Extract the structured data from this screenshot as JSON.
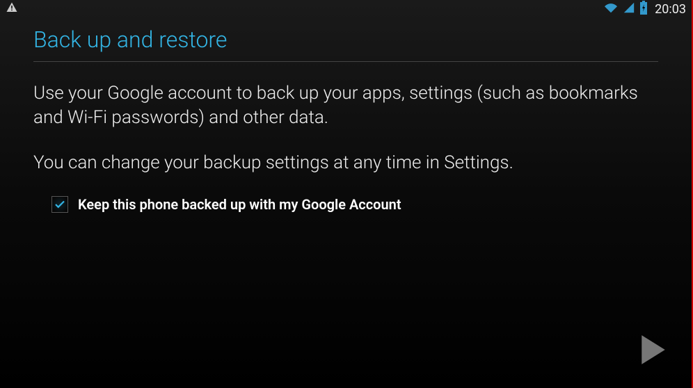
{
  "status_bar": {
    "time": "20:03"
  },
  "page": {
    "title": "Back up and restore",
    "paragraph1": "Use your Google account to back up your apps, settings (such as bookmarks and Wi-Fi passwords) and other data.",
    "paragraph2": "You can change your backup settings at any time in Settings.",
    "checkbox_label": "Keep this phone backed up with my Google Account",
    "checkbox_checked": true
  }
}
